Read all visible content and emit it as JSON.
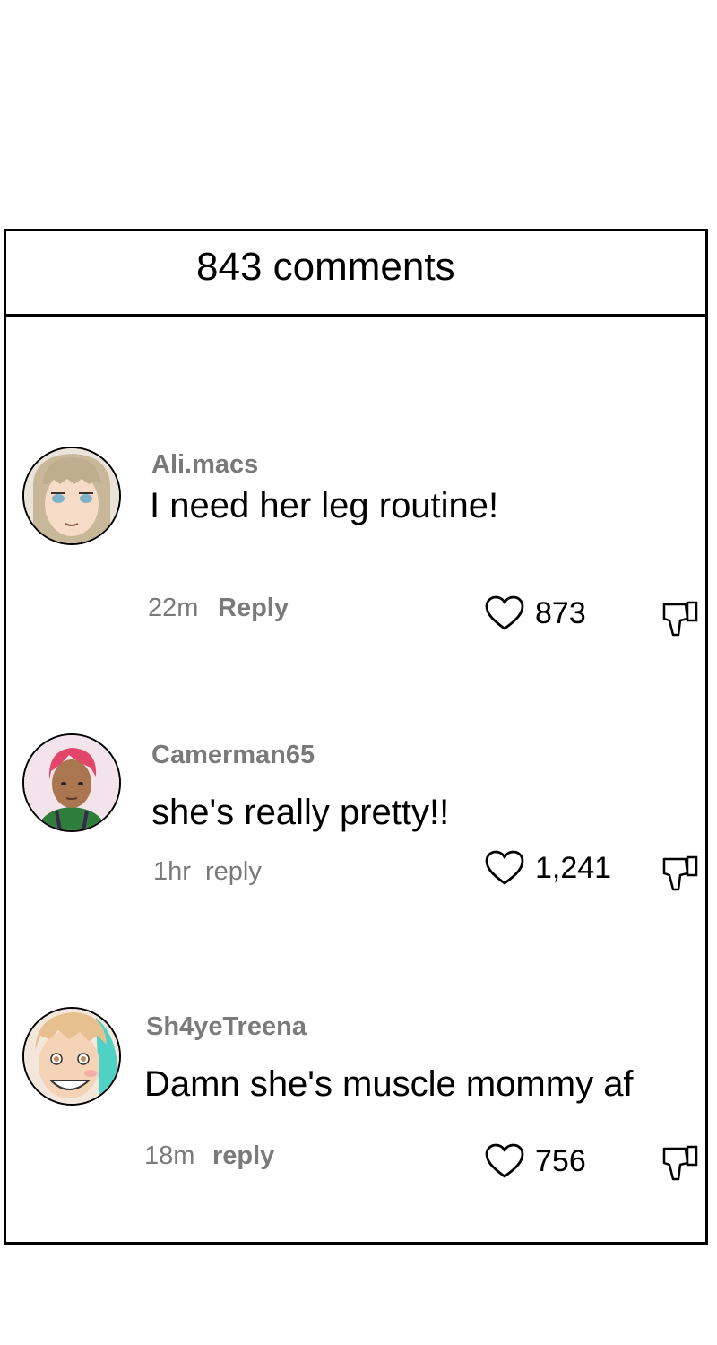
{
  "header": {
    "comment_count_label": "843 comments"
  },
  "comments": [
    {
      "username": "Ali.macs",
      "text": "I need her leg routine!",
      "time": "22m",
      "reply_label": "Reply",
      "likes": "873",
      "avatar_icon": "avatar-blonde-bangs"
    },
    {
      "username": "Camerman65",
      "text": "she's really pretty!!",
      "time": "1hr",
      "reply_label": "reply",
      "likes": "1,241",
      "avatar_icon": "avatar-pink-hair"
    },
    {
      "username": "Sh4yeTreena",
      "text": "Damn she's muscle mommy af",
      "time": "18m",
      "reply_label": "reply",
      "likes": "756",
      "avatar_icon": "avatar-smiling-teal-hair"
    }
  ],
  "icons": {
    "like": "heart-outline-icon",
    "dislike": "thumbs-down-outline-icon"
  },
  "colors": {
    "border": "#000000",
    "meta_text": "#7a7a7a",
    "background": "#ffffff"
  }
}
